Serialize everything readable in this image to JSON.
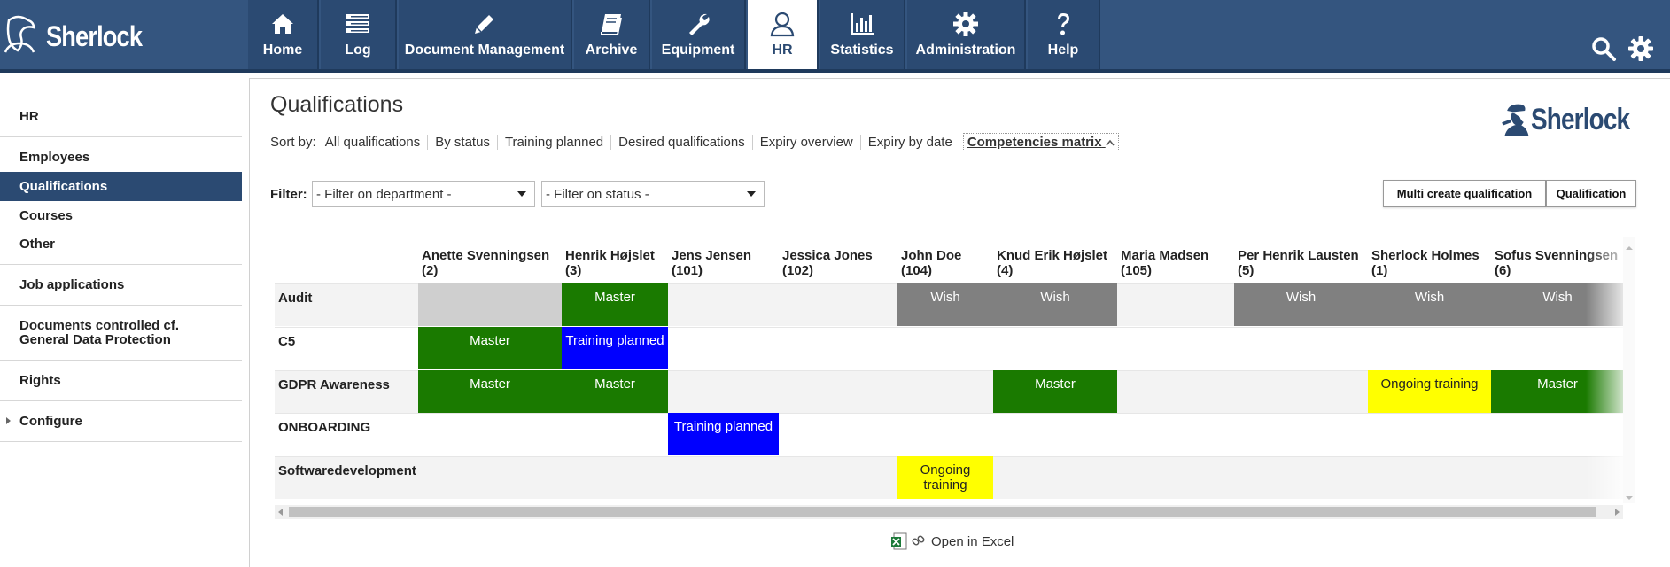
{
  "app": {
    "name": "Sherlock"
  },
  "nav": [
    {
      "id": "home",
      "label": "Home",
      "icon": "home-icon"
    },
    {
      "id": "log",
      "label": "Log",
      "icon": "log-icon"
    },
    {
      "id": "docs",
      "label": "Document Management",
      "icon": "pencil-icon"
    },
    {
      "id": "archive",
      "label": "Archive",
      "icon": "book-icon"
    },
    {
      "id": "equipment",
      "label": "Equipment",
      "icon": "wrench-icon"
    },
    {
      "id": "hr",
      "label": "HR",
      "icon": "person-icon",
      "active": true
    },
    {
      "id": "stats",
      "label": "Statistics",
      "icon": "bar-chart-icon"
    },
    {
      "id": "admin",
      "label": "Administration",
      "icon": "gear-icon"
    },
    {
      "id": "help",
      "label": "Help",
      "icon": "question-icon"
    }
  ],
  "sidebar": {
    "items": [
      {
        "label": "HR"
      },
      {
        "label": "Employees"
      },
      {
        "label": "Qualifications",
        "active": true
      },
      {
        "label": "Courses"
      },
      {
        "label": "Other"
      },
      {
        "label": "Job applications"
      },
      {
        "label": "Documents controlled cf. General Data Protection"
      },
      {
        "label": "Rights"
      },
      {
        "label": "Configure"
      }
    ]
  },
  "page": {
    "title": "Qualifications",
    "sort_label": "Sort by:",
    "sort_options": [
      "All qualifications",
      "By status",
      "Training planned",
      "Desired qualifications",
      "Expiry overview",
      "Expiry by date",
      "Competencies matrix"
    ],
    "filter_label": "Filter:",
    "filter_department": "- Filter on department -",
    "filter_status": "- Filter on status -",
    "btn_multi": "Multi create qualification",
    "btn_qualification": "Qualification",
    "excel_label": "Open in Excel"
  },
  "matrix": {
    "columns": [
      {
        "name": "Anette Svenningsen",
        "id": "(2)"
      },
      {
        "name": "Henrik Højslet",
        "id": "(3)"
      },
      {
        "name": "Jens Jensen",
        "id": "(101)"
      },
      {
        "name": "Jessica Jones",
        "id": "(102)"
      },
      {
        "name": "John Doe",
        "id": "(104)"
      },
      {
        "name": "Knud Erik Højslet",
        "id": "(4)"
      },
      {
        "name": "Maria Madsen",
        "id": "(105)"
      },
      {
        "name": "Per Henrik Lausten",
        "id": "(5)"
      },
      {
        "name": "Sherlock Holmes",
        "id": "(1)"
      },
      {
        "name": "Sofus Svenningsen",
        "id": "(6)"
      }
    ],
    "rows": [
      {
        "label": "Audit",
        "cells": [
          "blank",
          "Master",
          "",
          "",
          "Wish",
          "Wish",
          "",
          "Wish",
          "Wish",
          "Wish"
        ]
      },
      {
        "label": "C5",
        "cells": [
          "Master",
          "Training planned",
          "",
          "",
          "",
          "",
          "",
          "",
          "",
          ""
        ]
      },
      {
        "label": "GDPR Awareness",
        "cells": [
          "Master",
          "Master",
          "",
          "",
          "",
          "Master",
          "",
          "",
          "Ongoing training",
          "Master"
        ]
      },
      {
        "label": "ONBOARDING",
        "cells": [
          "",
          "",
          "Training planned",
          "",
          "",
          "",
          "",
          "",
          "",
          ""
        ]
      },
      {
        "label": "Softwaredevelopment",
        "cells": [
          "",
          "",
          "",
          "",
          "Ongoing training",
          "",
          "",
          "",
          "",
          ""
        ]
      }
    ],
    "colors": {
      "Master": "#1a7a00",
      "Training planned": "#0000ff",
      "Wish": "#808080",
      "Ongoing training": "#ffff00"
    }
  }
}
